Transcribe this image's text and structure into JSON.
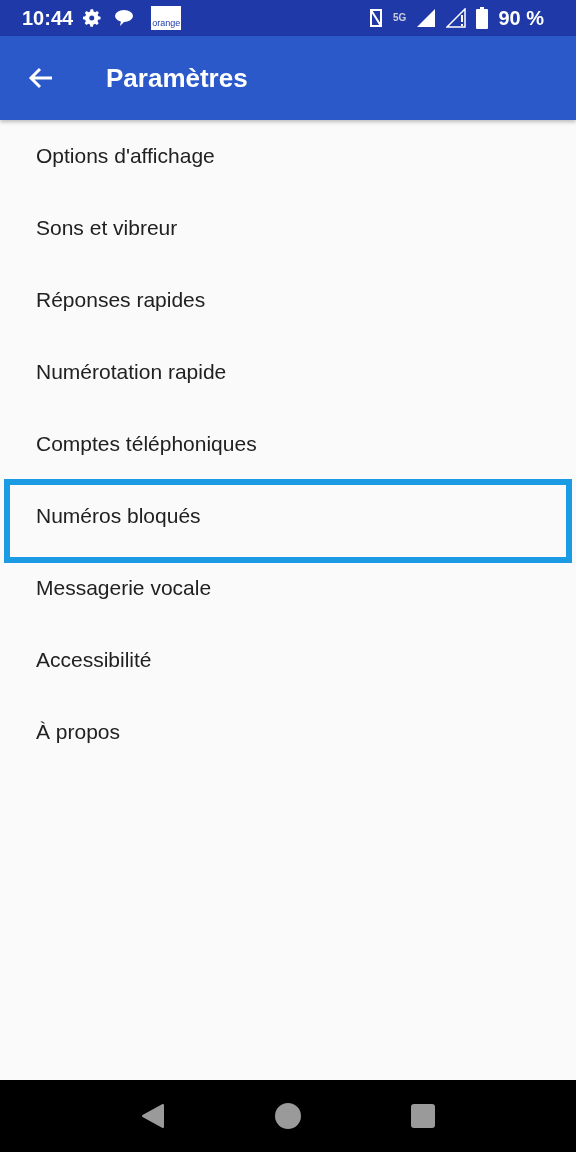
{
  "status_bar": {
    "time": "10:44",
    "carrier_logo": "orange",
    "network": "5G",
    "battery": "90 %"
  },
  "app_bar": {
    "title": "Paramètres"
  },
  "settings": [
    {
      "label": "Options d'affichage",
      "highlighted": false
    },
    {
      "label": "Sons et vibreur",
      "highlighted": false
    },
    {
      "label": "Réponses rapides",
      "highlighted": false
    },
    {
      "label": "Numérotation rapide",
      "highlighted": false
    },
    {
      "label": "Comptes téléphoniques",
      "highlighted": false
    },
    {
      "label": "Numéros bloqués",
      "highlighted": true
    },
    {
      "label": "Messagerie vocale",
      "highlighted": false
    },
    {
      "label": "Accessibilité",
      "highlighted": false
    },
    {
      "label": "À propos",
      "highlighted": false
    }
  ]
}
